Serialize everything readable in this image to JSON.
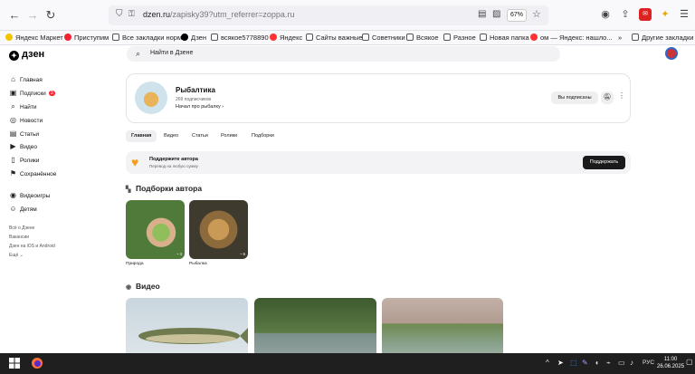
{
  "browser": {
    "url_host": "dzen.ru",
    "url_path": "/zapisky39?utm_referrer=zoppa.ru",
    "zoom": "67%",
    "bookmarks": [
      {
        "label": "Яндекс Маркет",
        "type": "site",
        "color": "#f5c400"
      },
      {
        "label": "Приступим",
        "type": "site",
        "color": "#e23"
      },
      {
        "label": "Все закладки норм",
        "type": "folder"
      },
      {
        "label": "Дзен",
        "type": "site",
        "color": "#000"
      },
      {
        "label": "всякое5778890",
        "type": "folder"
      },
      {
        "label": "Яндекс",
        "type": "site",
        "color": "#f33"
      },
      {
        "label": "Сайты важные",
        "type": "folder"
      },
      {
        "label": "Советники",
        "type": "folder"
      },
      {
        "label": "Всякое",
        "type": "folder"
      },
      {
        "label": "Разное",
        "type": "folder"
      },
      {
        "label": "Новая папка",
        "type": "folder"
      },
      {
        "label": "ом — Яндекс: нашло...",
        "type": "site",
        "color": "#f33"
      }
    ],
    "other_bookmarks": "Другие закладки",
    "overflow": "»"
  },
  "header": {
    "logo": "дзен",
    "search_placeholder": "Найти в Дзене"
  },
  "sidebar": {
    "items": [
      {
        "label": "Главная",
        "icon": "⌂"
      },
      {
        "label": "Подписки",
        "icon": "▣",
        "badge": "3"
      },
      {
        "label": "Найти",
        "icon": "⌕"
      },
      {
        "label": "Новости",
        "icon": "◎"
      },
      {
        "label": "Статьи",
        "icon": "▤"
      },
      {
        "label": "Видео",
        "icon": "▶"
      },
      {
        "label": "Ролики",
        "icon": "▯"
      },
      {
        "label": "Сохранённое",
        "icon": "⚑"
      }
    ],
    "items2": [
      {
        "label": "Видеоигры",
        "icon": "◉"
      },
      {
        "label": "Детям",
        "icon": "☺"
      }
    ],
    "links": [
      "Всё о Дзене",
      "Вакансии",
      "Дзен на iOS и Android",
      "Ещё ⌄"
    ]
  },
  "channel": {
    "name": "Рыбалтика",
    "subscribers": "269 подписчиков",
    "description": "Начал про рыбалку ›",
    "subscribed_label": "Вы подписаны"
  },
  "tabs": [
    "Главная",
    "Видео",
    "Статьи",
    "Ролики",
    "Подборки"
  ],
  "donate": {
    "title": "Поддержите автора",
    "subtitle": "Перевод на любую сумму",
    "button": "Поддержать"
  },
  "collections": {
    "title": "Подборки автора",
    "items": [
      {
        "caption": "Природа",
        "count": "◔ 4"
      },
      {
        "caption": "Рыбалка",
        "count": "◔ 6"
      }
    ]
  },
  "videos": {
    "title": "Видео"
  },
  "taskbar": {
    "lang": "РУС",
    "time": "11:00",
    "date": "26.06.2025"
  }
}
